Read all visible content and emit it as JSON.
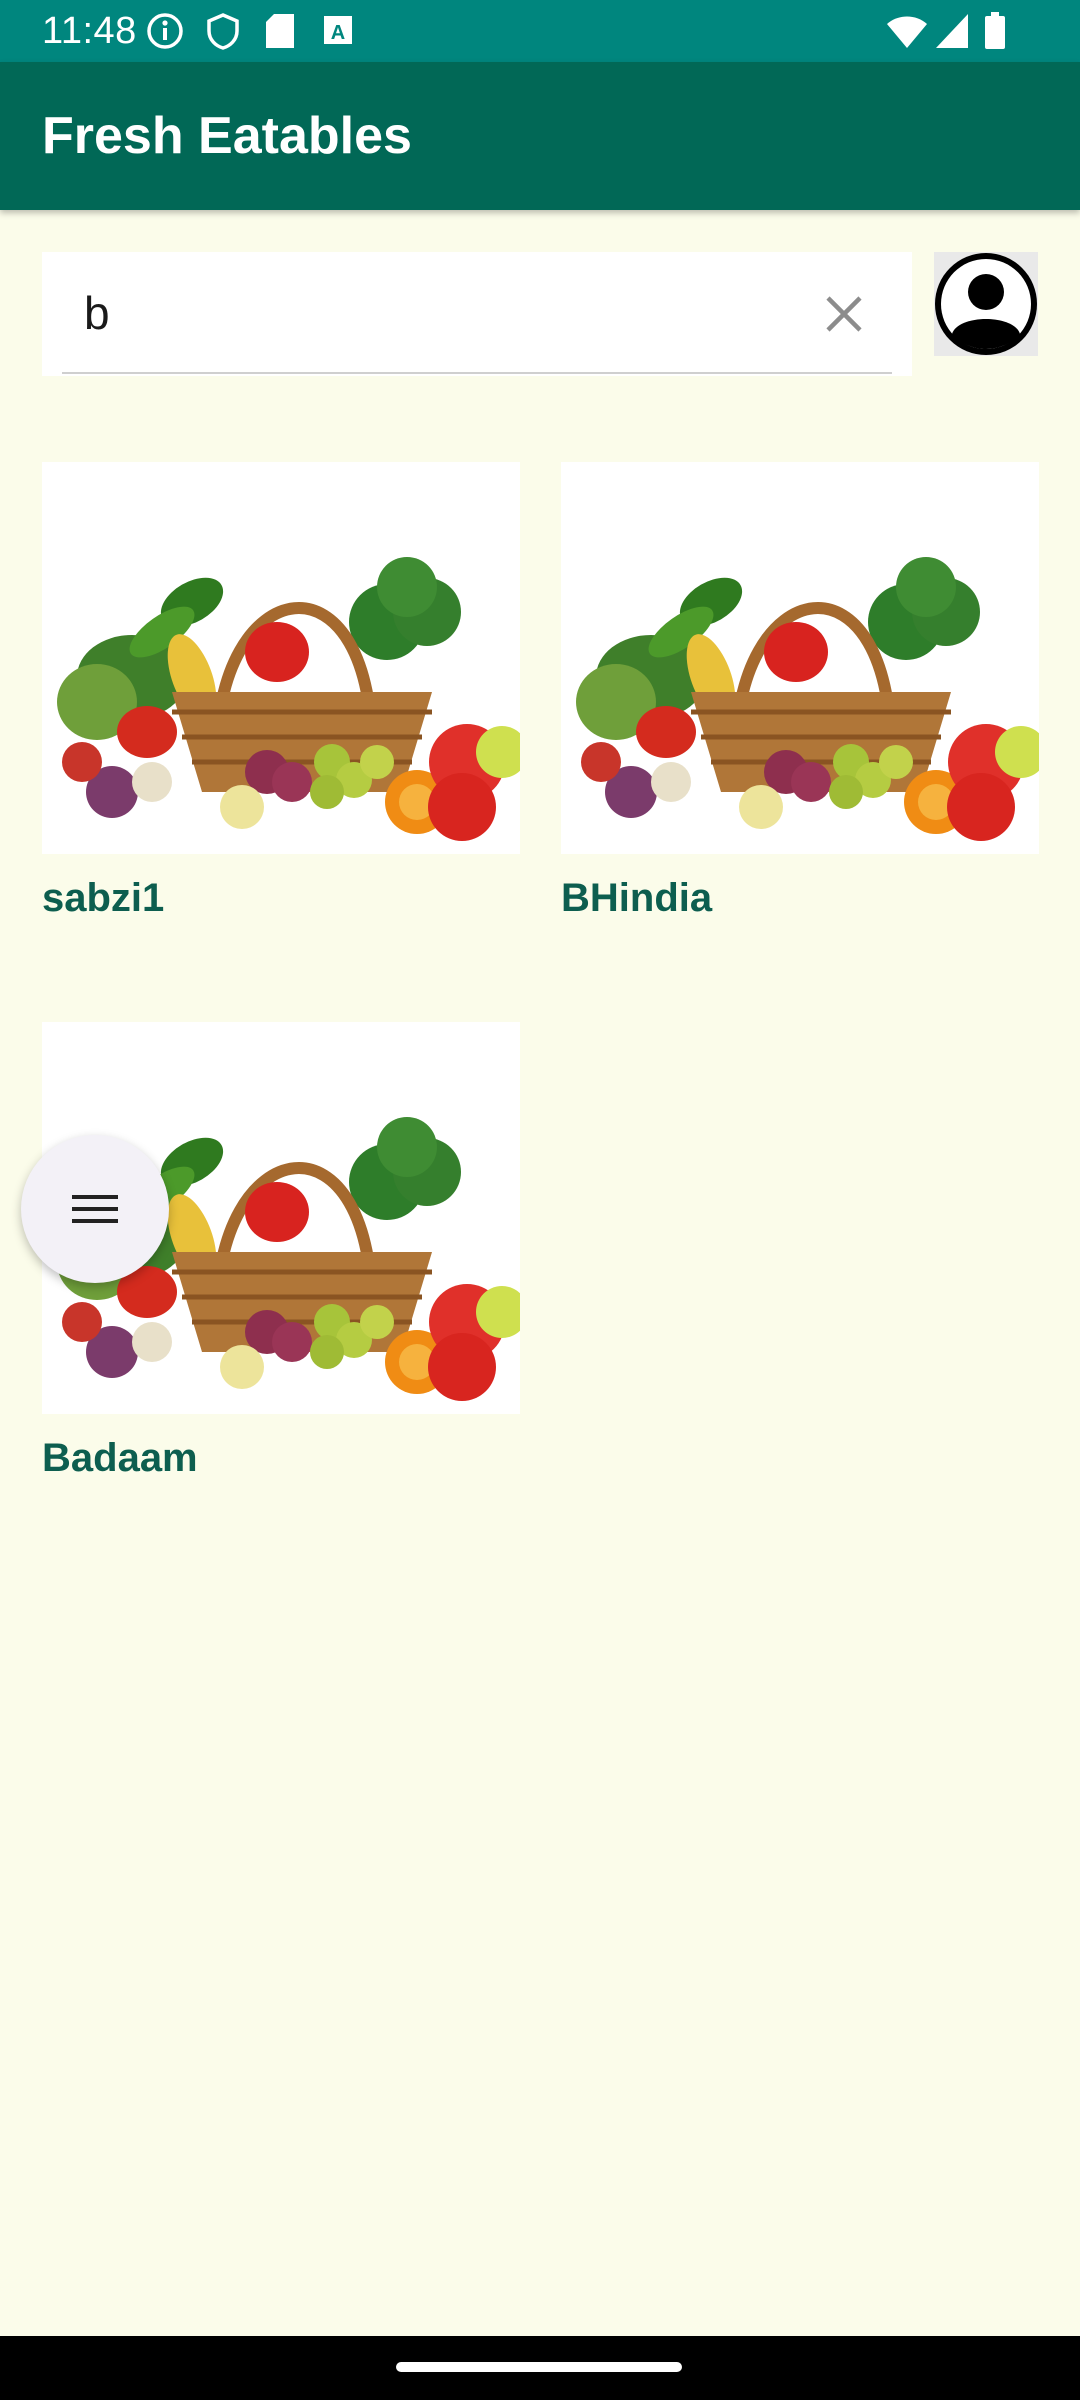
{
  "status_bar": {
    "time": "11:48",
    "icons": [
      "info-icon",
      "shield-icon",
      "sd-card-icon",
      "a-icon",
      "wifi-icon",
      "signal-icon",
      "battery-icon"
    ]
  },
  "app_bar": {
    "title": "Fresh Eatables"
  },
  "search": {
    "value": "b",
    "clear_icon": "close-icon"
  },
  "profile": {
    "icon": "user-avatar-icon"
  },
  "products": [
    {
      "name": "sabzi1",
      "image": "vegetable-basket"
    },
    {
      "name": "BHindia",
      "image": "vegetable-basket"
    },
    {
      "name": "Badaam",
      "image": "vegetable-basket"
    }
  ],
  "fab": {
    "icon": "menu-icon"
  },
  "colors": {
    "status_bar": "#00867E",
    "app_bar": "#016856",
    "background": "#FBFCEA",
    "product_name": "#0D5E4F",
    "fab": "#F3F1F7"
  }
}
